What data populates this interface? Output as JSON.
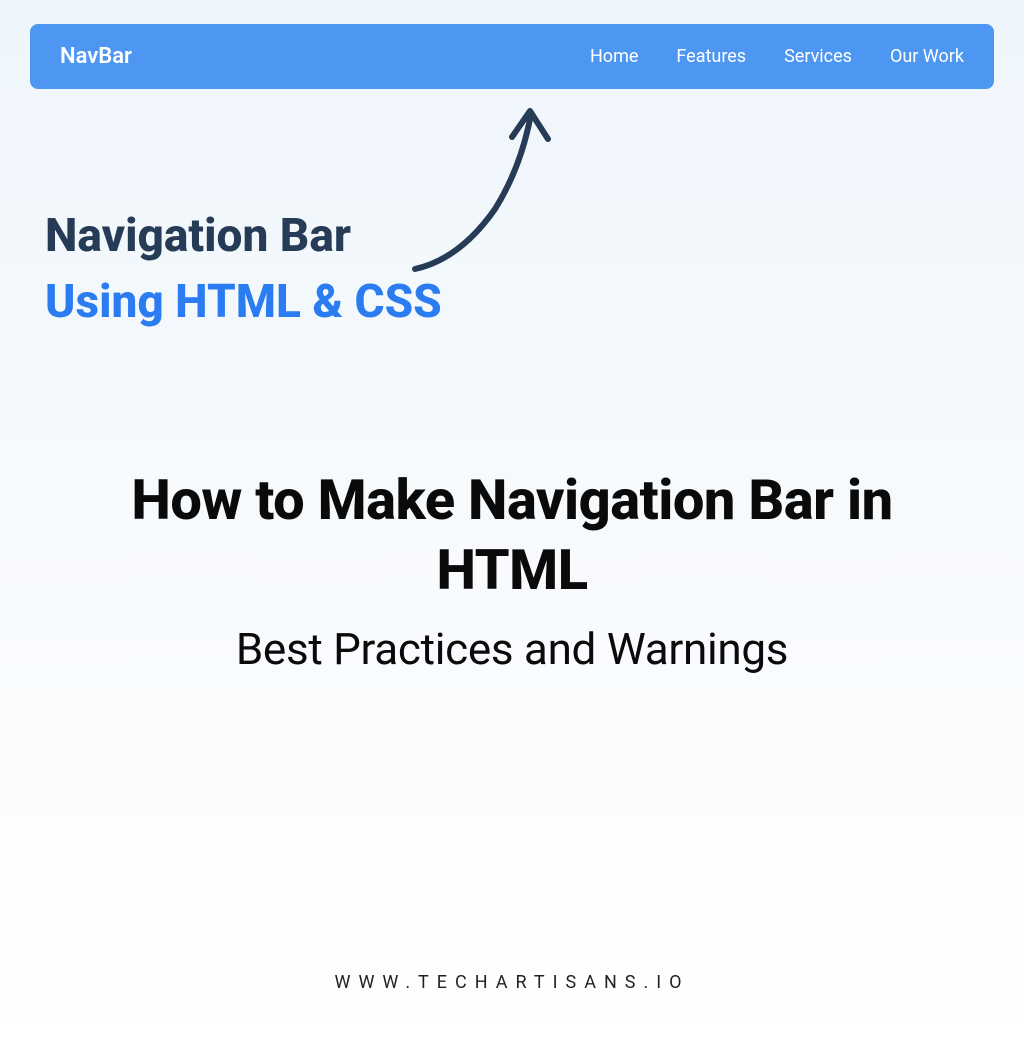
{
  "navbar": {
    "brand": "NavBar",
    "links": [
      "Home",
      "Features",
      "Services",
      "Our Work"
    ]
  },
  "hero": {
    "line1": "Navigation Bar",
    "line2": "Using HTML & CSS"
  },
  "article": {
    "title": "How to Make Navigation Bar in HTML",
    "subtitle": "Best Practices and Warnings"
  },
  "footer": {
    "url": "WWW.TECHARTISANS.IO"
  }
}
